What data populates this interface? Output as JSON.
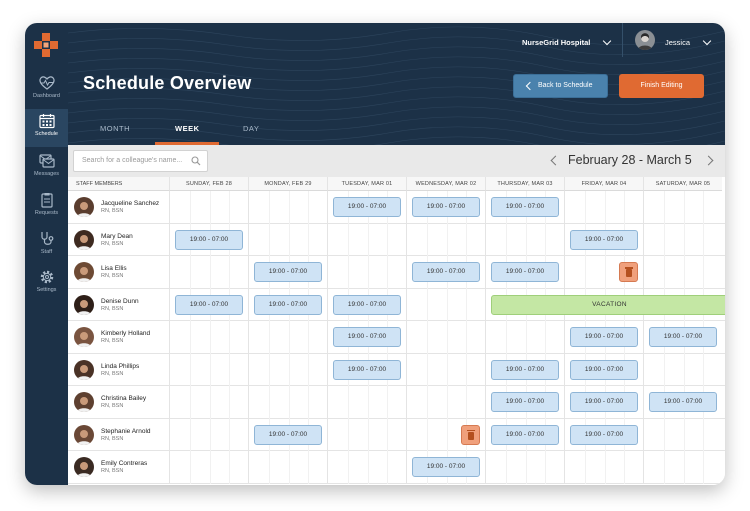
{
  "app": {
    "hospital": "NurseGrid Hospital",
    "user_name": "Jessica",
    "page_title": "Schedule Overview"
  },
  "sidebar": {
    "items": [
      {
        "label": "Dashboard",
        "icon": "heartbeat-icon"
      },
      {
        "label": "Schedule",
        "icon": "calendar-icon",
        "active": true
      },
      {
        "label": "Messages",
        "icon": "messages-icon"
      },
      {
        "label": "Requests",
        "icon": "clipboard-icon"
      },
      {
        "label": "Staff",
        "icon": "stethoscope-icon"
      },
      {
        "label": "Settings",
        "icon": "gear-icon"
      }
    ]
  },
  "header": {
    "back_label": "Back to Schedule",
    "finish_label": "Finish Editing",
    "tabs": [
      {
        "label": "MONTH"
      },
      {
        "label": "WEEK",
        "active": true
      },
      {
        "label": "DAY"
      }
    ]
  },
  "toolbar": {
    "search_placeholder": "Search for a colleague's name...",
    "date_range": "February 28 - March 5"
  },
  "grid": {
    "staff_header": "STAFF MEMBERS",
    "days": [
      "SUNDAY, FEB 28",
      "MONDAY, FEB 29",
      "TUESDAY, MAR 01",
      "WEDNESDAY, MAR 02",
      "THURSDAY, MAR 03",
      "FRIDAY, MAR 04",
      "SATURDAY, MAR 05"
    ],
    "vacation_label": "VACATION",
    "staff": [
      {
        "name": "Jacqueline Sanchez",
        "cred": "RN, BSN",
        "shifts": [
          "",
          "",
          "19:00 - 07:00",
          "19:00 - 07:00",
          "19:00 - 07:00",
          "",
          ""
        ]
      },
      {
        "name": "Mary Dean",
        "cred": "RN, BSN",
        "shifts": [
          "19:00 - 07:00",
          "",
          "",
          "",
          "",
          "19:00 - 07:00",
          ""
        ]
      },
      {
        "name": "Lisa Ellis",
        "cred": "RN, BSN",
        "shifts": [
          "",
          "19:00 - 07:00",
          "",
          "19:00 - 07:00",
          "19:00 - 07:00",
          "TRASH",
          ""
        ]
      },
      {
        "name": "Denise Dunn",
        "cred": "RN, BSN",
        "shifts": [
          "19:00 - 07:00",
          "19:00 - 07:00",
          "19:00 - 07:00",
          "",
          "VACATION",
          "VACATION",
          "VACATION"
        ]
      },
      {
        "name": "Kimberly Holland",
        "cred": "RN, BSN",
        "shifts": [
          "",
          "",
          "19:00 - 07:00",
          "",
          "",
          "19:00 - 07:00",
          "19:00 - 07:00"
        ]
      },
      {
        "name": "Linda Phillips",
        "cred": "RN, BSN",
        "shifts": [
          "",
          "",
          "19:00 - 07:00",
          "",
          "19:00 - 07:00",
          "19:00 - 07:00",
          ""
        ]
      },
      {
        "name": "Christina Bailey",
        "cred": "RN, BSN",
        "shifts": [
          "",
          "",
          "",
          "",
          "19:00 - 07:00",
          "19:00 - 07:00",
          "19:00 - 07:00"
        ]
      },
      {
        "name": "Stephanie Arnold",
        "cred": "RN, BSN",
        "shifts": [
          "",
          "19:00 - 07:00",
          "",
          "TRASH",
          "19:00 - 07:00",
          "19:00 - 07:00",
          ""
        ]
      },
      {
        "name": "Emily Contreras",
        "cred": "RN, BSN",
        "shifts": [
          "",
          "",
          "",
          "19:00 - 07:00",
          "",
          "",
          ""
        ]
      }
    ]
  },
  "colors": {
    "navy": "#1c3147",
    "accent_orange": "#e06a32",
    "button_blue": "#4a82ad",
    "shift_blue": "#cfe3f5",
    "vacation_green": "#c4e7a4"
  }
}
